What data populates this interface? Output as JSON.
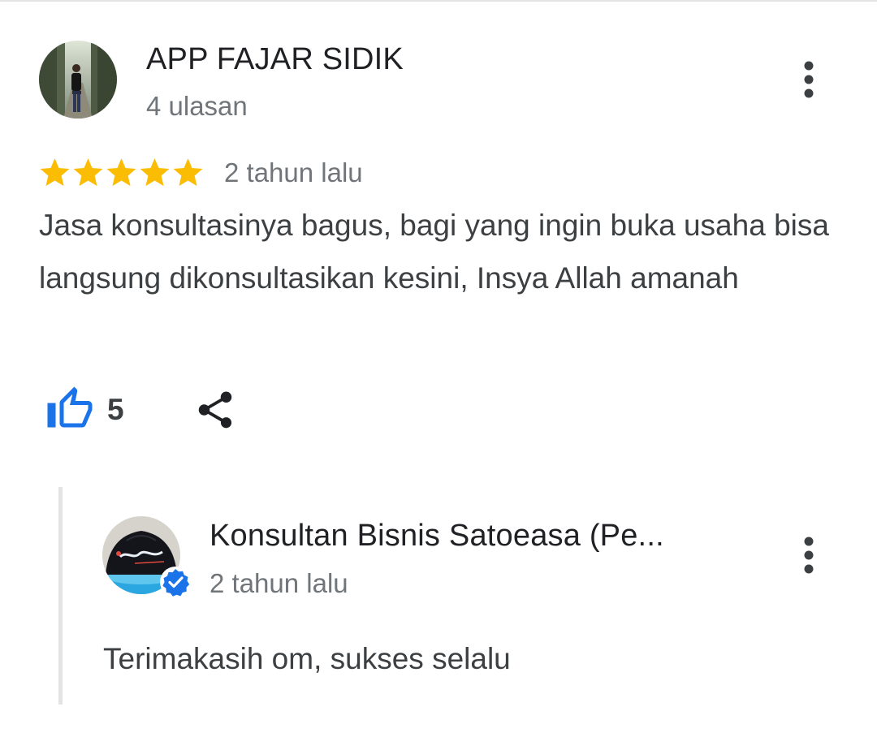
{
  "review": {
    "author_name": "APP FAJAR SIDIK",
    "author_meta": "4 ulasan",
    "rating": 5,
    "rating_max": 5,
    "time": "2 tahun lalu",
    "text": "Jasa konsultasinya bagus, bagi yang ingin buka usaha bisa langsung dikonsultasikan kesini, Insya Allah amanah",
    "likes": "5",
    "star_color": "#fbbc04",
    "like_color": "#1a73e8"
  },
  "owner_reply": {
    "name": "Konsultan Bisnis Satoeasa (Pe...",
    "time": "2 tahun lalu",
    "text": "Terimakasih om, sukses selalu",
    "verified_color": "#1a73e8"
  },
  "icons": {
    "more": "more-vert-icon",
    "like": "thumb-up-icon",
    "share": "share-icon",
    "star": "star-icon",
    "verified": "verified-check-icon"
  }
}
